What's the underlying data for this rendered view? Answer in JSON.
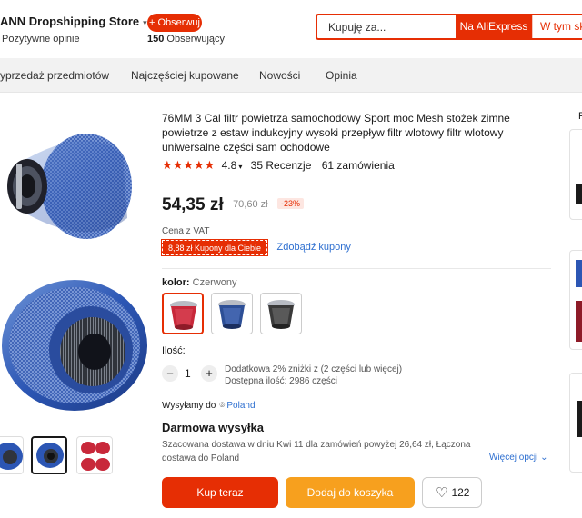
{
  "store": {
    "name": "ANN Dropshipping Store",
    "rating_text": "Pozytywne opinie",
    "follow_label": "+ Obserwuj",
    "followers_count": "150",
    "followers_label": "Obserwujący"
  },
  "search": {
    "placeholder": "Kupuję za...",
    "aliexpress_label": "Na AliExpress",
    "store_label": "W tym skl"
  },
  "nav": {
    "items": [
      "yprzedaż przedmiotów",
      "Najczęściej kupowane",
      "Nowości",
      "Opinia"
    ]
  },
  "product": {
    "title": "76MM 3 Cal filtr powietrza samochodowy Sport moc Mesh stożek zimne powietrze z estaw indukcyjny wysoki przepływ filtr wlotowy filtr wlotowy uniwersalne części sam ochodowe",
    "stars": "★★★★★",
    "rating": "4.8",
    "reviews": "35 Recenzje",
    "orders": "61 zamówienia",
    "price": "54,35 zł",
    "old_price": "70,60 zł",
    "discount": "-23%",
    "vat_text": "Cena z VAT",
    "coupon_badge": "8,88 zł Kupony dla Ciebie",
    "coupon_link": "Zdobądź kupony",
    "color_label": "kolor:",
    "color_value": "Czerwony",
    "colors": [
      {
        "name": "Czerwony",
        "hex": "#c8283a",
        "selected": true
      },
      {
        "name": "Niebieski",
        "hex": "#2d4f96",
        "selected": false
      },
      {
        "name": "Czarny",
        "hex": "#3a3a3a",
        "selected": false
      }
    ],
    "quantity_label": "Ilość:",
    "quantity": "1",
    "quantity_promo": "Dodatkowa 2% zniżki z (2 części lub więcej)",
    "available": "Dostępna ilość: 2986 części",
    "ship_to_label": "Wysyłamy do",
    "ship_to_country": "Poland",
    "free_shipping": "Darmowa wysyłka",
    "shipping_detail": "Szacowana dostawa w dniu Kwi 11 dla zamówień powyżej 26,64 zł, Łączona dostawa do Poland",
    "more_options": "Więcej opcji",
    "buy_now": "Kup teraz",
    "add_to_cart": "Dodaj do koszyka",
    "wishlist_count": "122"
  },
  "right_strip": {
    "letter": "F"
  },
  "colors": {
    "accent": "#e62e04",
    "cart": "#f7a01e",
    "link": "#2e6fd0"
  }
}
